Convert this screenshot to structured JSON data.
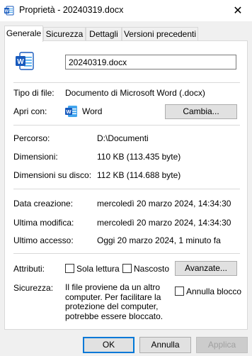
{
  "titlebar": {
    "title": "Proprietà - 20240319.docx",
    "close_glyph": "✕"
  },
  "tabs": [
    {
      "label": "Generale"
    },
    {
      "label": "Sicurezza"
    },
    {
      "label": "Dettagli"
    },
    {
      "label": "Versioni precedenti"
    }
  ],
  "general": {
    "file_name": "20240319.docx",
    "file_type_label": "Tipo di file:",
    "file_type_value": "Documento di Microsoft Word (.docx)",
    "open_with_label": "Apri con:",
    "open_with_app": "Word",
    "change_button": "Cambia...",
    "path_label": "Percorso:",
    "path_value": "D:\\Documenti",
    "size_label": "Dimensioni:",
    "size_value": "110 KB (113.435 byte)",
    "disk_size_label": "Dimensioni su disco:",
    "disk_size_value": "112 KB (114.688 byte)",
    "created_label": "Data creazione:",
    "created_value": "mercoledì 20 marzo 2024, 14:34:30",
    "modified_label": "Ultima modifica:",
    "modified_value": "mercoledì 20 marzo 2024, 14:34:30",
    "accessed_label": "Ultimo accesso:",
    "accessed_value": "Oggi 20 marzo 2024, 1 minuto fa",
    "attributes_label": "Attributi:",
    "readonly_label": "Sola lettura",
    "hidden_label": "Nascosto",
    "advanced_button": "Avanzate...",
    "security_label": "Sicurezza:",
    "security_text_1": "Il file proviene da un altro",
    "security_text_2": "computer. Per facilitare la",
    "security_text_3": "protezione del computer,",
    "security_text_4": "potrebbe essere bloccato.",
    "unblock_label": "Annulla blocco"
  },
  "footer": {
    "ok": "OK",
    "cancel": "Annulla",
    "apply": "Applica"
  },
  "colors": {
    "word_blue": "#185abd",
    "word_blue_light": "#41a5ee",
    "accent": "#0078d7"
  },
  "icons": [
    "word-doc-icon",
    "word-app-icon",
    "close-icon"
  ]
}
